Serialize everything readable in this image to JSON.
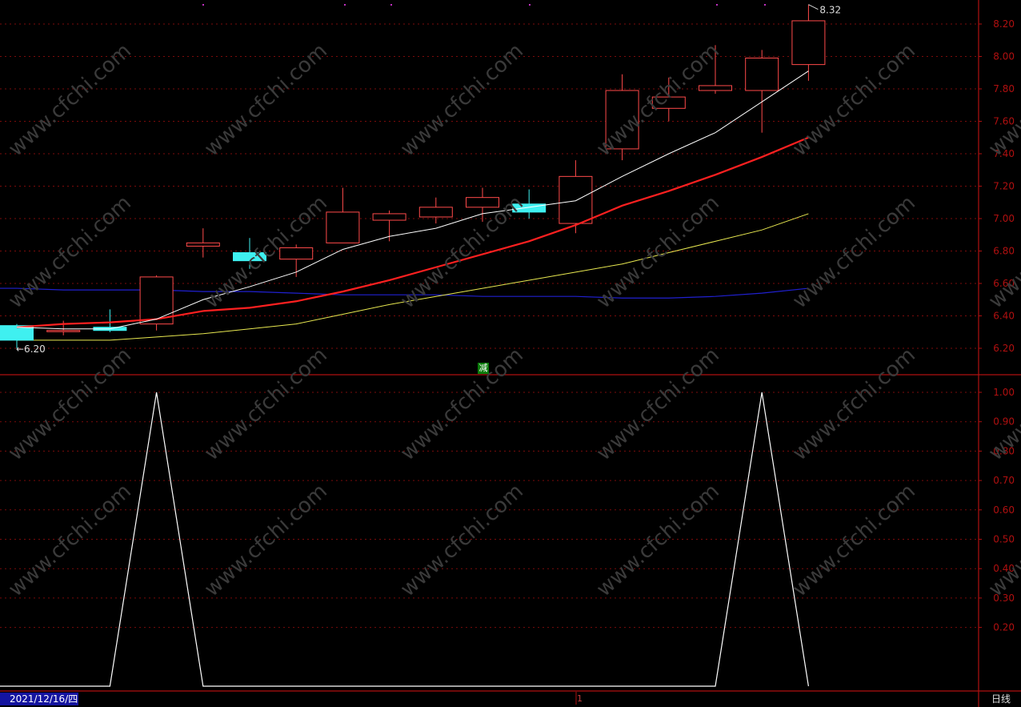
{
  "chart_data": {
    "type": "candlestick",
    "period": "日线",
    "date": "2021/12/16/四",
    "signal_label": "减",
    "page_marker": "1",
    "watermark": "www.cfchi.com",
    "colors": {
      "background": "#000000",
      "axis": "#b01010",
      "up_candle": "#ff4a4a",
      "down_candle": "#3ff0f0",
      "ma_short": "#ffffff",
      "ma_mid": "#ff2020",
      "ma_long": "#e8e850",
      "ma_ext": "#2020d0",
      "indicator": "#ffffff"
    },
    "price_axis": {
      "ylim": [
        6.0,
        8.32
      ],
      "ticks": [
        "6.20",
        "6.40",
        "6.60",
        "6.80",
        "7.00",
        "7.20",
        "7.40",
        "7.60",
        "7.80",
        "8.00",
        "8.20"
      ],
      "high_label": "8.32",
      "low_label": "6.20"
    },
    "indicator_axis": {
      "ylim": [
        0,
        1.0
      ],
      "ticks": [
        "0.20",
        "0.30",
        "0.40",
        "0.50",
        "0.60",
        "0.70",
        "0.80",
        "0.90",
        "1.00"
      ]
    },
    "candles": [
      {
        "open": 6.34,
        "close": 6.25,
        "high": 6.35,
        "low": 6.2
      },
      {
        "open": 6.31,
        "close": 6.31,
        "high": 6.37,
        "low": 6.28
      },
      {
        "open": 6.33,
        "close": 6.31,
        "high": 6.44,
        "low": 6.3
      },
      {
        "open": 6.35,
        "close": 6.64,
        "high": 6.65,
        "low": 6.31
      },
      {
        "open": 6.83,
        "close": 6.85,
        "high": 6.94,
        "low": 6.76
      },
      {
        "open": 6.79,
        "close": 6.74,
        "high": 6.88,
        "low": 6.69
      },
      {
        "open": 6.75,
        "close": 6.82,
        "high": 6.84,
        "low": 6.64
      },
      {
        "open": 6.85,
        "close": 7.04,
        "high": 7.19,
        "low": 6.85
      },
      {
        "open": 6.99,
        "close": 7.03,
        "high": 7.05,
        "low": 6.86
      },
      {
        "open": 7.01,
        "close": 7.07,
        "high": 7.13,
        "low": 6.97
      },
      {
        "open": 7.07,
        "close": 7.13,
        "high": 7.19,
        "low": 6.98
      },
      {
        "open": 7.09,
        "close": 7.04,
        "high": 7.18,
        "low": 7.0
      },
      {
        "open": 6.97,
        "close": 7.26,
        "high": 7.36,
        "low": 6.91
      },
      {
        "open": 7.43,
        "close": 7.79,
        "high": 7.89,
        "low": 7.36
      },
      {
        "open": 7.68,
        "close": 7.75,
        "high": 7.87,
        "low": 7.6
      },
      {
        "open": 7.79,
        "close": 7.82,
        "high": 8.07,
        "low": 7.77
      },
      {
        "open": 7.79,
        "close": 7.99,
        "high": 8.04,
        "low": 7.53
      },
      {
        "open": 7.95,
        "close": 8.22,
        "high": 8.32,
        "low": 7.85
      }
    ],
    "ma_short": [
      6.33,
      6.32,
      6.32,
      6.38,
      6.5,
      6.58,
      6.67,
      6.81,
      6.89,
      6.94,
      7.03,
      7.07,
      7.11,
      7.26,
      7.4,
      7.53,
      7.72,
      7.91
    ],
    "ma_mid": [
      6.33,
      6.35,
      6.36,
      6.38,
      6.43,
      6.45,
      6.49,
      6.55,
      6.62,
      6.7,
      6.78,
      6.86,
      6.96,
      7.08,
      7.17,
      7.27,
      7.38,
      7.5
    ],
    "ma_long": [
      6.25,
      6.25,
      6.25,
      6.27,
      6.29,
      6.32,
      6.35,
      6.41,
      6.47,
      6.52,
      6.57,
      6.62,
      6.67,
      6.72,
      6.79,
      6.86,
      6.93,
      7.03
    ],
    "ma_ext": [
      6.57,
      6.56,
      6.56,
      6.56,
      6.55,
      6.55,
      6.54,
      6.53,
      6.53,
      6.53,
      6.52,
      6.52,
      6.52,
      6.51,
      6.51,
      6.52,
      6.54,
      6.57
    ],
    "indicator": [
      0,
      0,
      0,
      1,
      0,
      0,
      0,
      0,
      0,
      0,
      0,
      0,
      0,
      0,
      0,
      0,
      1,
      0
    ]
  }
}
